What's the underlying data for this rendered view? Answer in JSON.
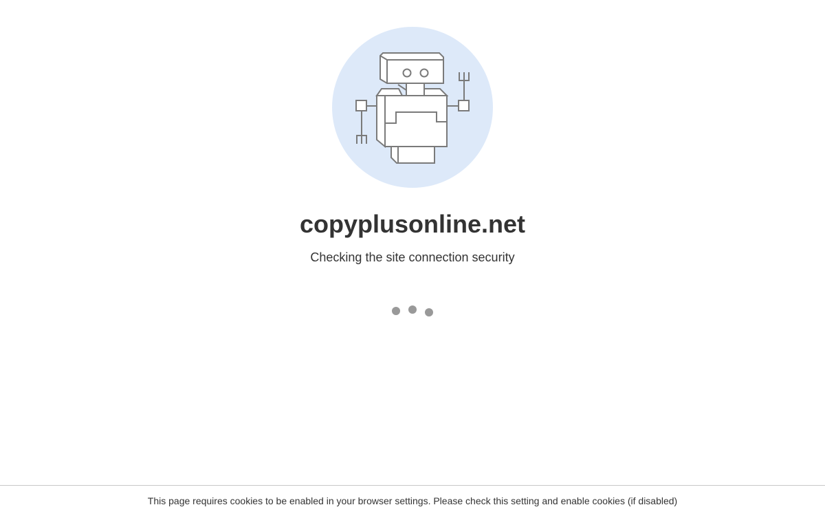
{
  "site": {
    "domain": "copyplusonline.net",
    "status": "Checking the site connection security"
  },
  "illustration": {
    "icon": "robot-icon",
    "background_color": "#dde9f9",
    "stroke_color": "#7a7a7a"
  },
  "loader": {
    "icon": "loading-dots",
    "dot_count": 3,
    "color": "#999999"
  },
  "footer": {
    "cookie_notice": "This page requires cookies to be enabled in your browser settings. Please check this setting and enable cookies (if disabled)"
  }
}
